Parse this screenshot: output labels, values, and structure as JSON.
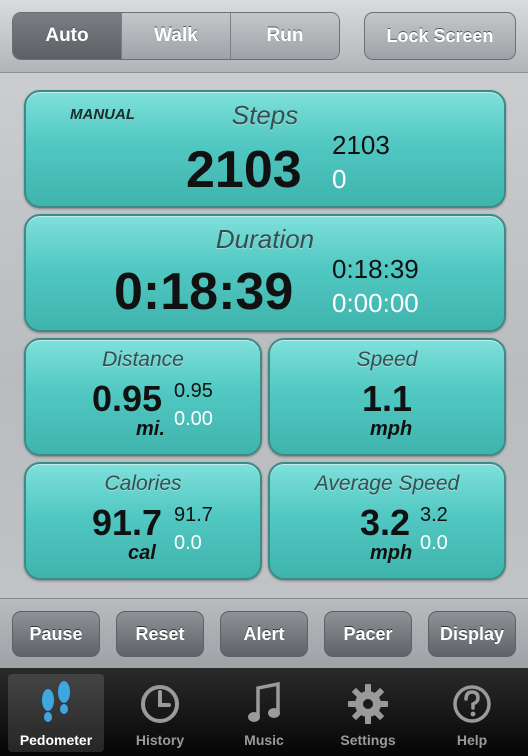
{
  "mode_tabs": [
    {
      "label": "Auto",
      "active": true
    },
    {
      "label": "Walk",
      "active": false
    },
    {
      "label": "Run",
      "active": false
    }
  ],
  "lock_label": "Lock Screen",
  "steps": {
    "title": "Steps",
    "tag": "MANUAL",
    "value": "2103",
    "sub1": "2103",
    "sub2": "0"
  },
  "duration": {
    "title": "Duration",
    "value": "0:18:39",
    "sub1": "0:18:39",
    "sub2": "0:00:00"
  },
  "distance": {
    "title": "Distance",
    "value": "0.95",
    "sub1": "0.95",
    "sub2": "0.00",
    "unit": "mi."
  },
  "speed": {
    "title": "Speed",
    "value": "1.1",
    "unit": "mph"
  },
  "calories": {
    "title": "Calories",
    "value": "91.7",
    "sub1": "91.7",
    "sub2": "0.0",
    "unit": "cal"
  },
  "avg_speed": {
    "title": "Average Speed",
    "value": "3.2",
    "sub1": "3.2",
    "sub2": "0.0",
    "unit": "mph"
  },
  "actions": {
    "pause": "Pause",
    "reset": "Reset",
    "alert": "Alert",
    "pacer": "Pacer",
    "display": "Display"
  },
  "tabs": [
    {
      "label": "Pedometer",
      "icon": "footprints-icon",
      "active": true
    },
    {
      "label": "History",
      "icon": "clock-icon",
      "active": false
    },
    {
      "label": "Music",
      "icon": "music-note-icon",
      "active": false
    },
    {
      "label": "Settings",
      "icon": "gear-icon",
      "active": false
    },
    {
      "label": "Help",
      "icon": "help-icon",
      "active": false
    }
  ],
  "colors": {
    "panel": "#52c8c2",
    "active_tab_icon": "#3ea7e0"
  }
}
